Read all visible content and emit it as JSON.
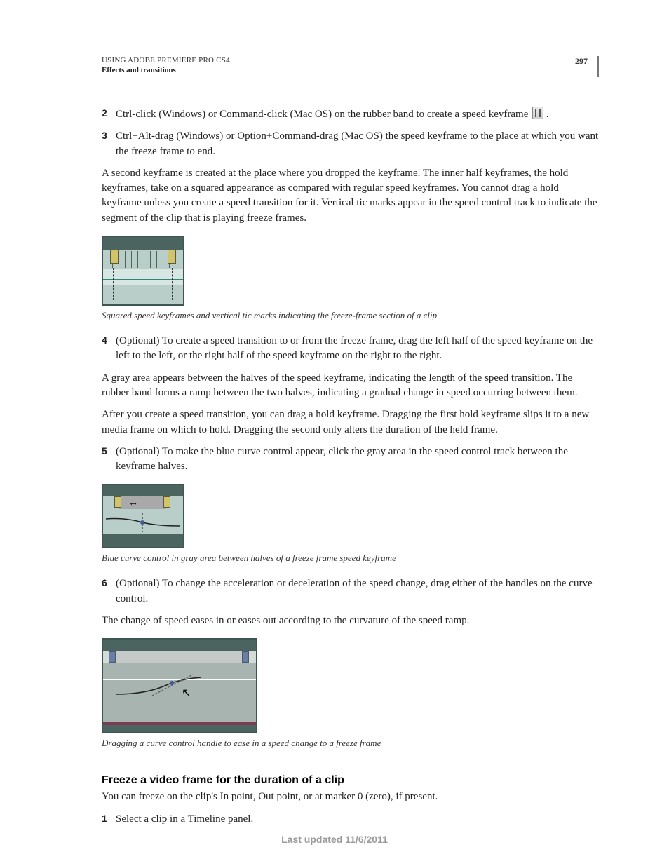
{
  "header": {
    "doc_title": "USING ADOBE PREMIERE PRO CS4",
    "section": "Effects and transitions",
    "page_number": "297"
  },
  "steps_a": [
    {
      "n": "2",
      "text": "Ctrl-click (Windows) or Command-click (Mac OS) on the rubber band to create a speed keyframe ",
      "trailing": "."
    },
    {
      "n": "3",
      "text": "Ctrl+Alt-drag (Windows) or Option+Command-drag (Mac OS) the speed keyframe to the place at which you want the freeze frame to end."
    }
  ],
  "para_a": "A second keyframe is created at the place where you dropped the keyframe. The inner half keyframes, the hold keyframes, take on a squared appearance as compared with regular speed keyframes. You cannot drag a hold keyframe unless you create a speed transition for it. Vertical tic marks appear in the speed control track to indicate the segment of the clip that is playing freeze frames.",
  "caption1": "Squared speed keyframes and vertical tic marks indicating the freeze-frame section of a clip",
  "steps_b": [
    {
      "n": "4",
      "text": "(Optional) To create a speed transition to or from the freeze frame, drag the left half of the speed keyframe on the left to the left, or the right half of the speed keyframe on the right to the right."
    }
  ],
  "para_b": "A gray area appears between the halves of the speed keyframe, indicating the length of the speed transition. The rubber band forms a ramp between the two halves, indicating a gradual change in speed occurring between them.",
  "para_c": "After you create a speed transition, you can drag a hold keyframe. Dragging the first hold keyframe slips it to a new media frame on which to hold. Dragging the second only alters the duration of the held frame.",
  "steps_c": [
    {
      "n": "5",
      "text": "(Optional) To make the blue curve control appear, click the gray area in the speed control track between the keyframe halves."
    }
  ],
  "caption2": "Blue curve control in gray area between halves of a freeze frame speed keyframe",
  "steps_d": [
    {
      "n": "6",
      "text": "(Optional) To change the acceleration or deceleration of the speed change, drag either of the handles on the curve control."
    }
  ],
  "para_d": "The change of speed eases in or eases out according to the curvature of the speed ramp.",
  "caption3": "Dragging a curve control handle to ease in a speed change to a freeze frame",
  "subhead": "Freeze a video frame for the duration of a clip",
  "para_e": "You can freeze on the clip's In point, Out point, or at marker 0 (zero), if present.",
  "steps_e": [
    {
      "n": "1",
      "text": "Select a clip in a Timeline panel."
    }
  ],
  "footer": "Last updated 11/6/2011"
}
